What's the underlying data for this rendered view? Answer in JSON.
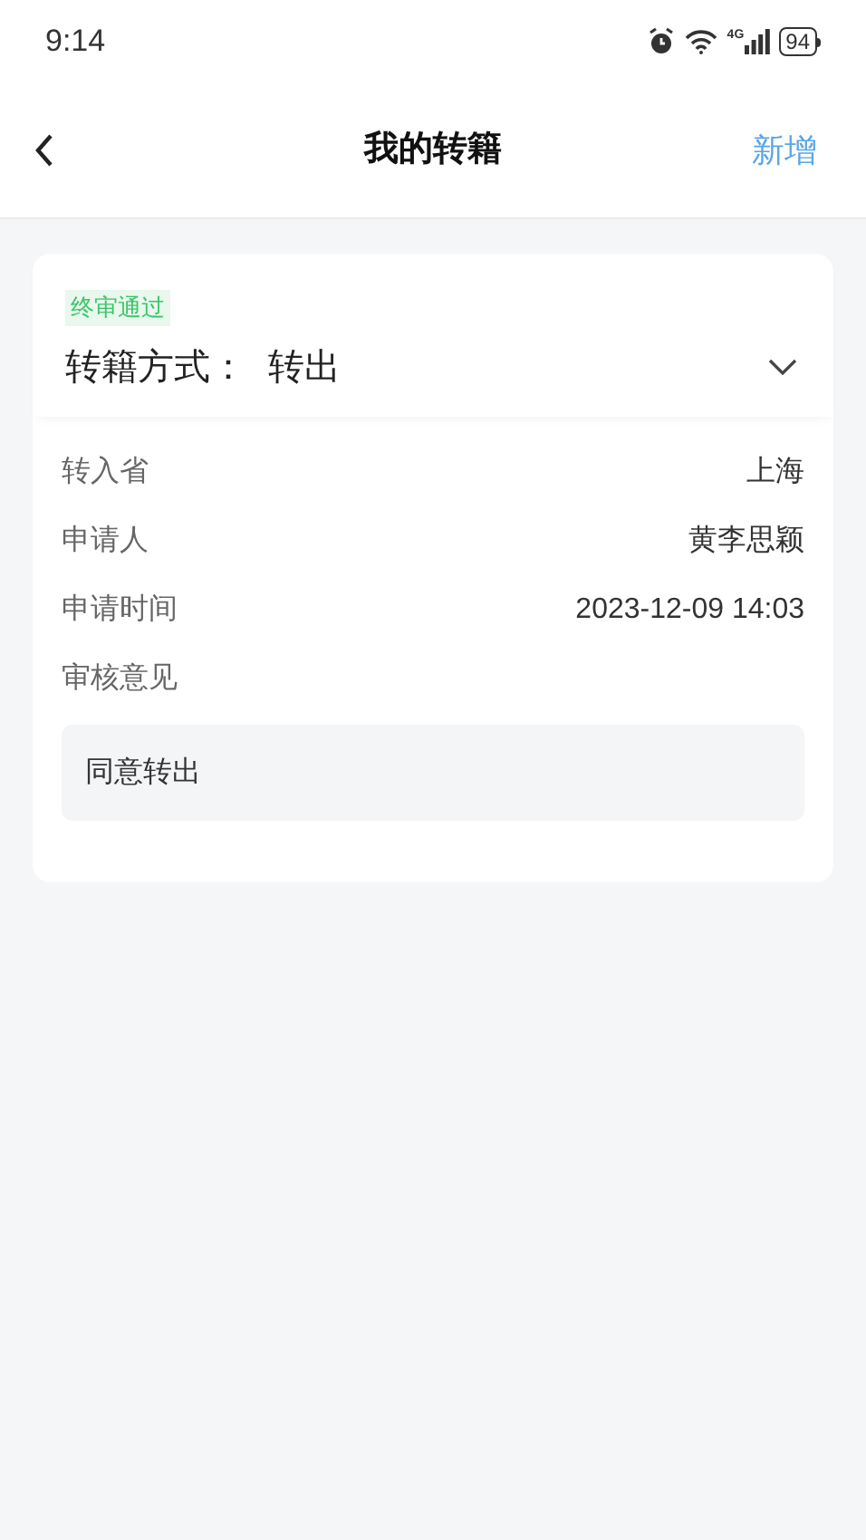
{
  "status_bar": {
    "time": "9:14",
    "network": "4G",
    "battery": "94"
  },
  "nav_bar": {
    "title": "我的转籍",
    "action": "新增"
  },
  "card": {
    "status_badge": "终审通过",
    "heading_label": "转籍方式：",
    "heading_value": "转出",
    "rows": [
      {
        "label": "转入省",
        "value": "上海"
      },
      {
        "label": "申请人",
        "value": "黄李思颖"
      },
      {
        "label": "申请时间",
        "value": "2023-12-09 14:03"
      },
      {
        "label": "审核意见"
      }
    ],
    "comment": "同意转出"
  }
}
